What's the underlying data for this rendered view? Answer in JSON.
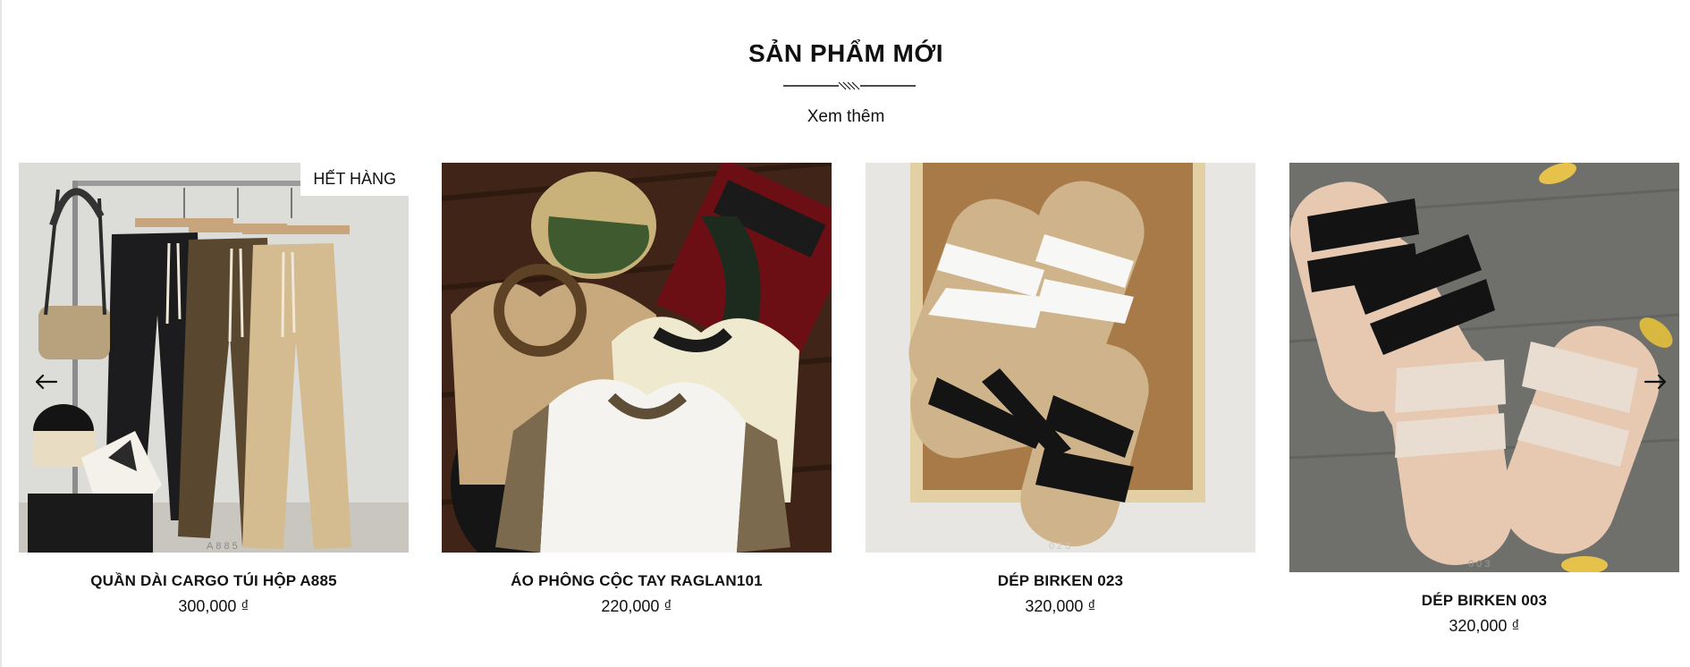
{
  "section": {
    "title": "SẢN PHẨM MỚI",
    "see_more": "Xem thêm"
  },
  "navigation": {
    "prev_icon": "arrow-left-icon",
    "next_icon": "arrow-right-icon"
  },
  "products": [
    {
      "name": "QUẦN DÀI CARGO TÚI HỘP A885",
      "price": "300,000 ₫",
      "badge": "HẾT HÀNG",
      "image_code": "A885"
    },
    {
      "name": "ÁO PHÔNG CỘC TAY RAGLAN101",
      "price": "220,000 ₫"
    },
    {
      "name": "DÉP BIRKEN 023",
      "price": "320,000 ₫",
      "image_code": "023"
    },
    {
      "name": "DÉP BIRKEN 003",
      "price": "320,000 ₫",
      "image_code": "003"
    }
  ]
}
